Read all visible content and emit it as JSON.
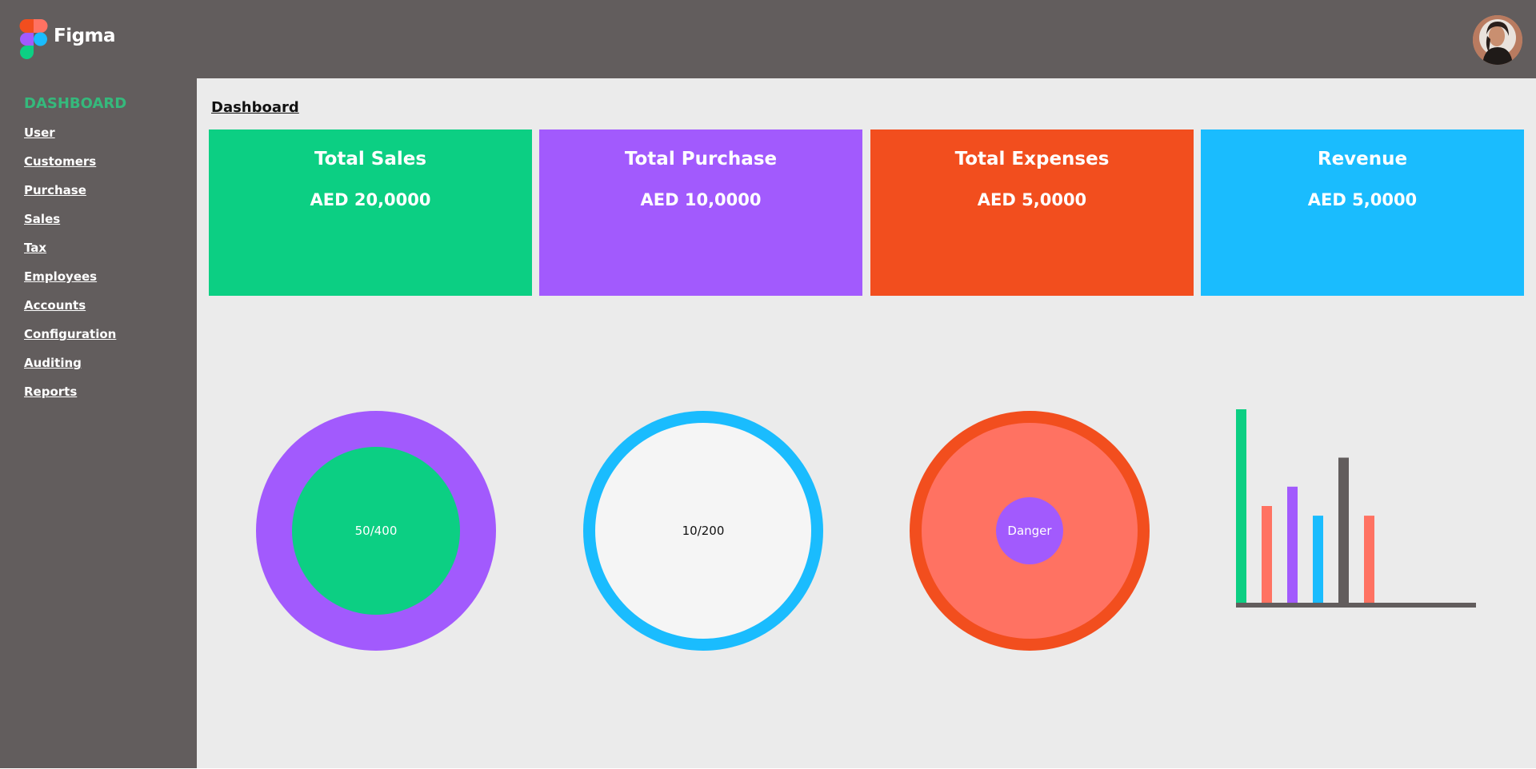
{
  "app": {
    "brand": "Figma"
  },
  "sidebar": {
    "heading": "DASHBOARD",
    "items": [
      {
        "label": "User"
      },
      {
        "label": "Customers"
      },
      {
        "label": "Purchase"
      },
      {
        "label": "Sales"
      },
      {
        "label": "Tax"
      },
      {
        "label": "Employees"
      },
      {
        "label": "Accounts"
      },
      {
        "label": "Configuration"
      },
      {
        "label": "Auditing"
      },
      {
        "label": "Reports"
      }
    ]
  },
  "main": {
    "title": "Dashboard",
    "cards": [
      {
        "title": "Total Sales",
        "value": "AED 20,0000",
        "color": "#0ccf83"
      },
      {
        "title": "Total Purchase",
        "value": "AED 10,0000",
        "color": "#a25afd"
      },
      {
        "title": "Total Expenses",
        "value": "AED 5,0000",
        "color": "#f24e1e"
      },
      {
        "title": "Revenue",
        "value": "AED 5,0000",
        "color": "#1abcfe"
      }
    ],
    "gauges": [
      {
        "label": "50/400",
        "outer_color": "#a25afd",
        "inner_color": "#0ccf83"
      },
      {
        "label": "10/200",
        "outer_color": "#1abcfe",
        "inner_color": "#f5f5f5"
      },
      {
        "label": "Danger",
        "outer_color": "#f24e1e",
        "middle_color": "#ff7262",
        "inner_color": "#a25afd"
      }
    ]
  },
  "chart_data": {
    "type": "bar",
    "title": "",
    "xlabel": "",
    "ylabel": "",
    "ylim": [
      0,
      200
    ],
    "values": [
      200,
      100,
      120,
      90,
      150,
      90
    ],
    "colors": [
      "#0ccf83",
      "#ff7262",
      "#a25afd",
      "#1abcfe",
      "#625d5d",
      "#ff7262"
    ]
  }
}
